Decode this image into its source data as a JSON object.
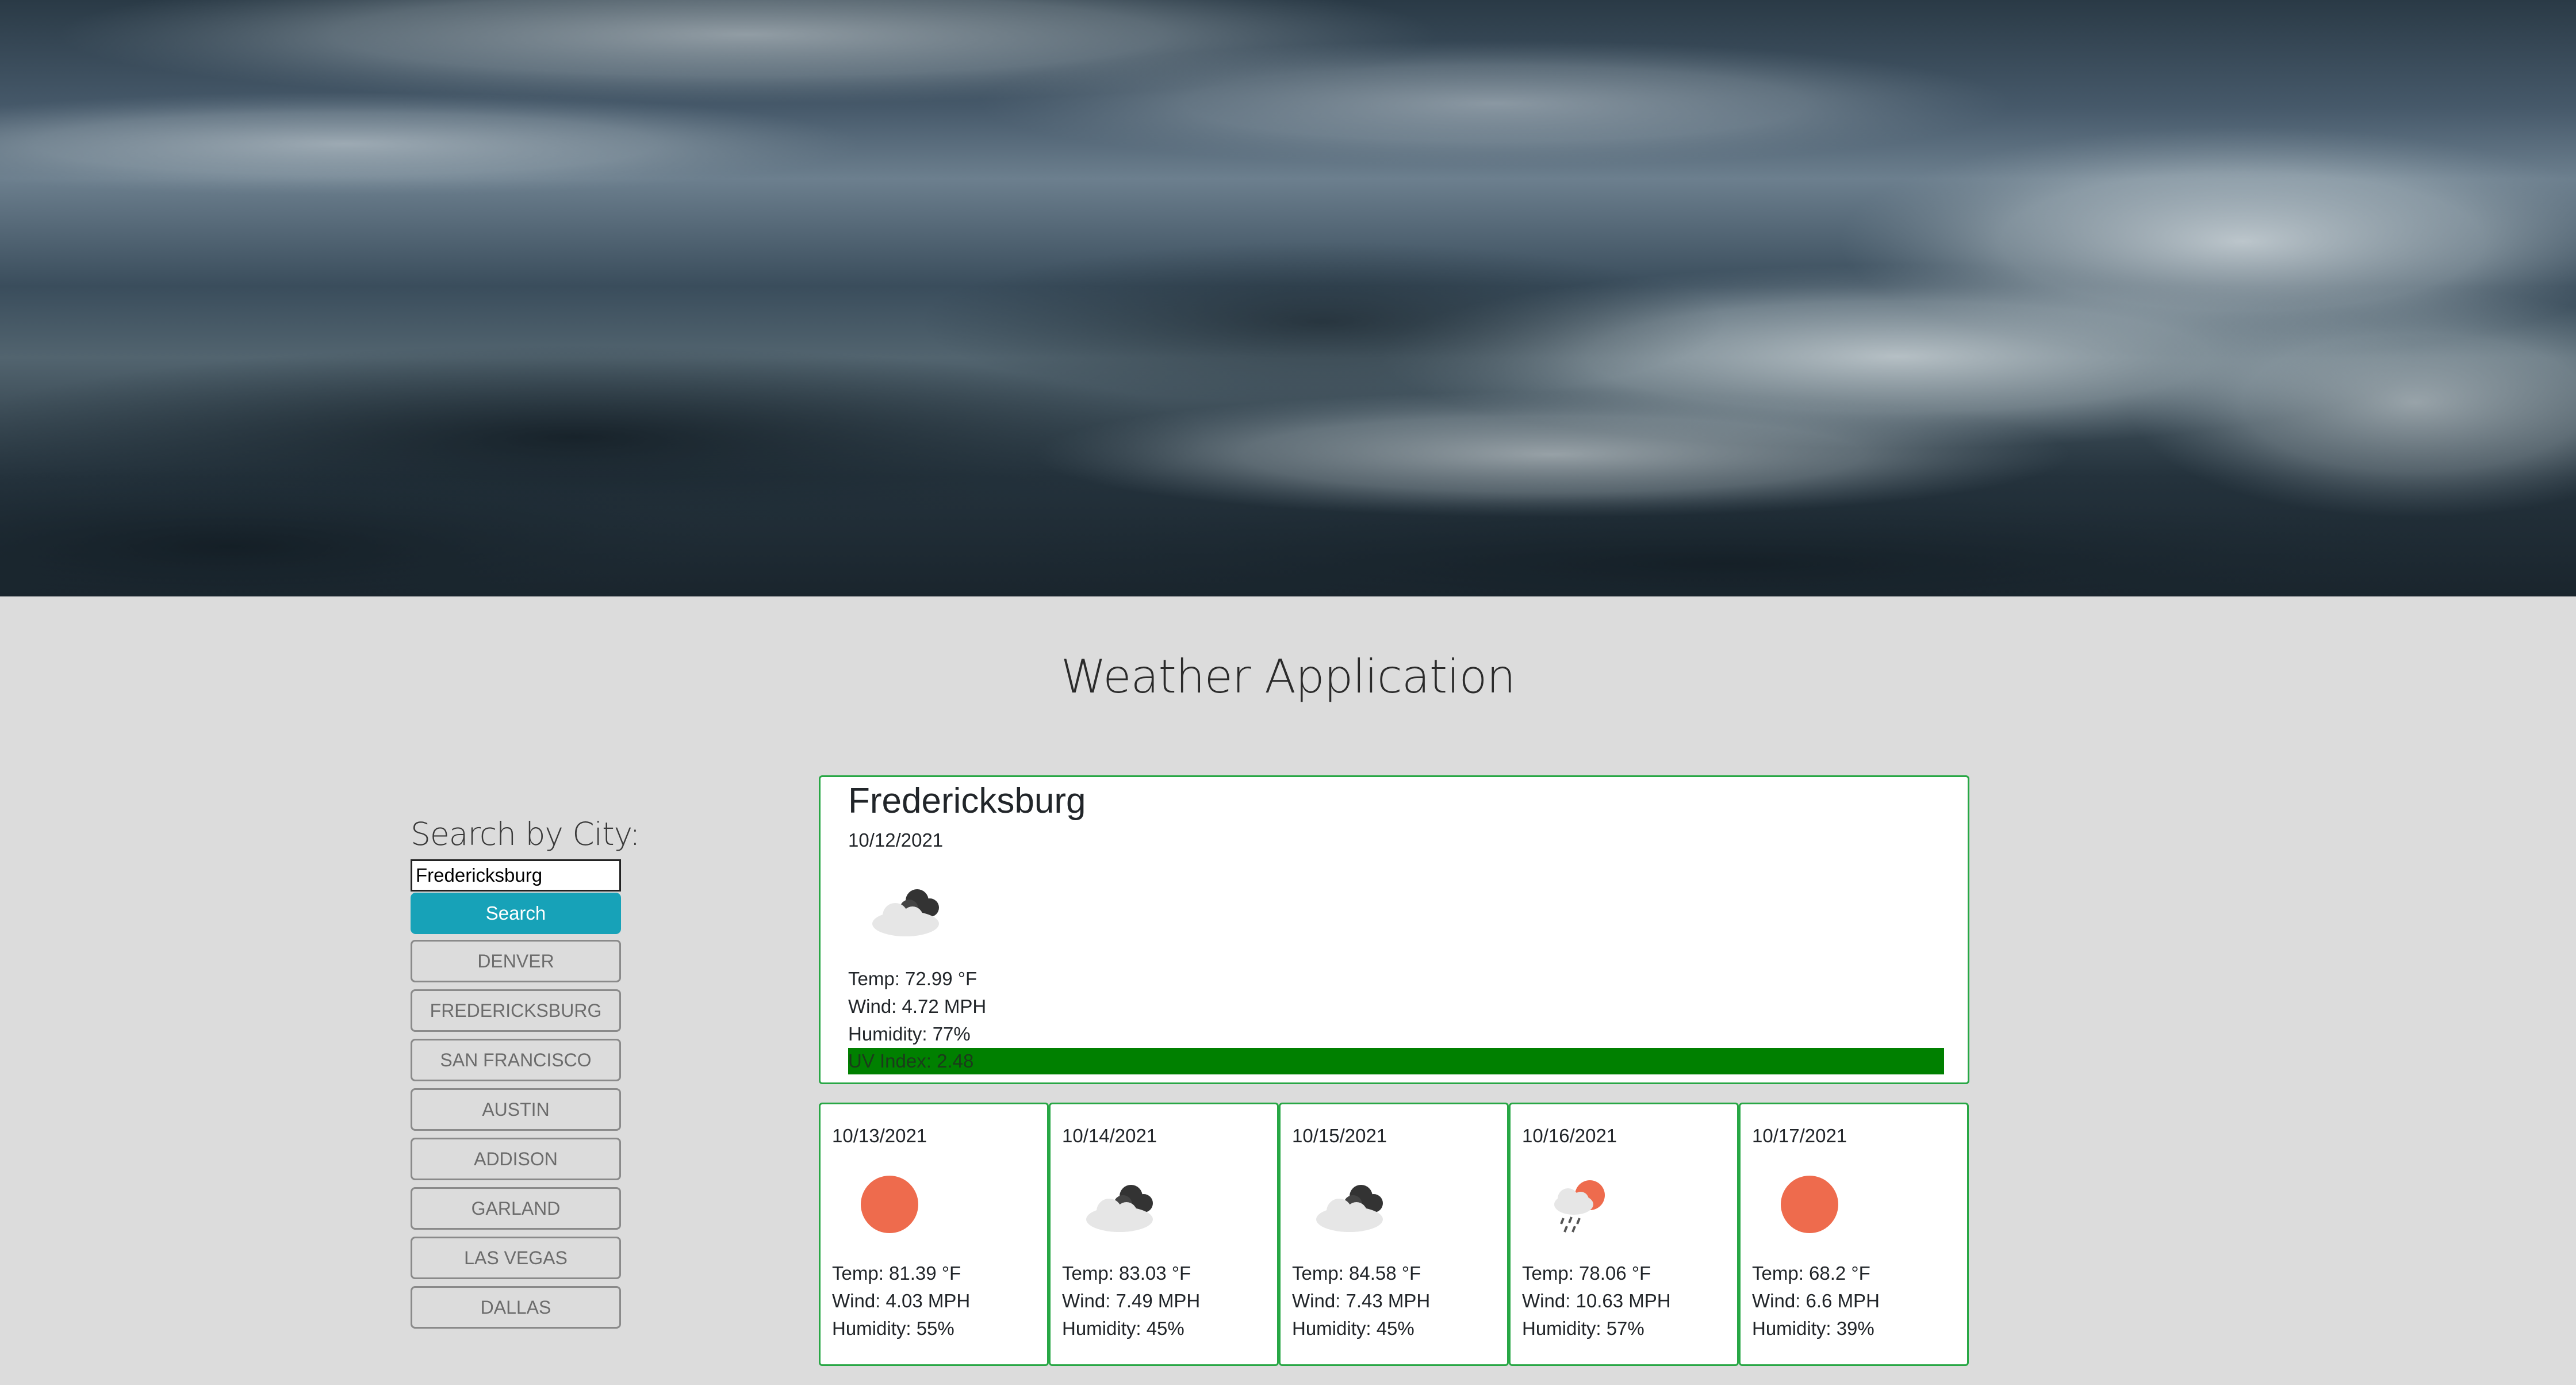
{
  "app": {
    "title": "Weather Application"
  },
  "search": {
    "label": "Search by City:",
    "input_value": "Fredericksburg",
    "button_label": "Search",
    "history": [
      "Denver",
      "Fredericksburg",
      "San Francisco",
      "Austin",
      "Addison",
      "Garland",
      "Las Vegas",
      "Dallas"
    ]
  },
  "current": {
    "city": "Fredericksburg",
    "date": "10/12/2021",
    "icon": "cloudy-icon",
    "temp": "Temp: 72.99 °F",
    "wind": "Wind: 4.72 MPH",
    "humidity": "Humidity: 77%",
    "uv": "UV Index: 2.48",
    "uv_color": "#008000"
  },
  "forecast": [
    {
      "date": "10/13/2021",
      "icon": "sun-icon",
      "temp": "Temp: 81.39 °F",
      "wind": "Wind: 4.03 MPH",
      "humidity": "Humidity: 55%"
    },
    {
      "date": "10/14/2021",
      "icon": "cloudy-icon",
      "temp": "Temp: 83.03 °F",
      "wind": "Wind: 7.49 MPH",
      "humidity": "Humidity: 45%"
    },
    {
      "date": "10/15/2021",
      "icon": "cloudy-icon",
      "temp": "Temp: 84.58 °F",
      "wind": "Wind: 7.43 MPH",
      "humidity": "Humidity: 45%"
    },
    {
      "date": "10/16/2021",
      "icon": "rain-sun-icon",
      "temp": "Temp: 78.06 °F",
      "wind": "Wind: 10.63 MPH",
      "humidity": "Humidity: 57%"
    },
    {
      "date": "10/17/2021",
      "icon": "sun-icon",
      "temp": "Temp: 68.2 °F",
      "wind": "Wind: 6.6 MPH",
      "humidity": "Humidity: 39%"
    }
  ],
  "colors": {
    "accent": "#17a2b8",
    "card_border": "#28a745",
    "sun": "#ee6b4d"
  }
}
